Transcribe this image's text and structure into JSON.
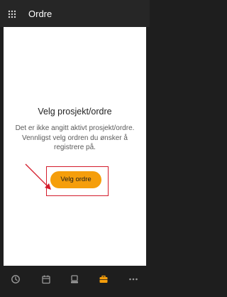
{
  "header": {
    "title": "Ordre",
    "menu_icon": "grid-menu-icon"
  },
  "main": {
    "heading": "Velg prosjekt/ordre",
    "description": "Det er ikke angitt aktivt prosjekt/ordre. Vennligst velg ordren du ønsker å registrere på.",
    "button_label": "Velg ordre"
  },
  "tabbar": {
    "items": [
      {
        "icon": "clock-icon",
        "active": false
      },
      {
        "icon": "calendar-icon",
        "active": false
      },
      {
        "icon": "computer-icon",
        "active": false
      },
      {
        "icon": "briefcase-icon",
        "active": true
      },
      {
        "icon": "more-icon",
        "active": false
      }
    ]
  },
  "colors": {
    "accent": "#f59e0b",
    "highlight_border": "#d41c2c",
    "arrow": "#d41c2c",
    "background": "#1e1e1e",
    "content_background": "#ffffff"
  }
}
